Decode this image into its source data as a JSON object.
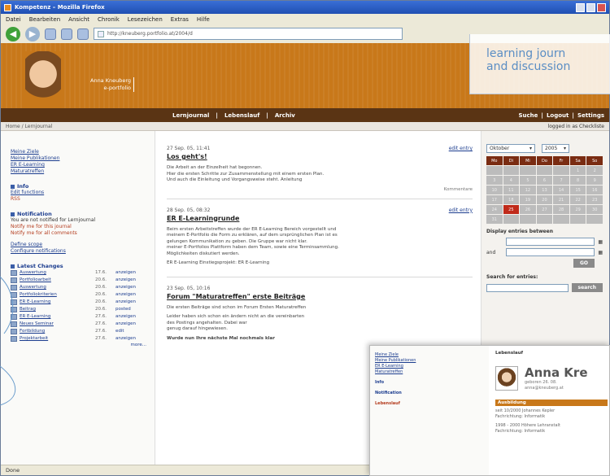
{
  "window": {
    "title": "Kompetenz – Mozilla Firefox",
    "menu": [
      "Datei",
      "Bearbeiten",
      "Ansicht",
      "Chronik",
      "Lesezeichen",
      "Extras",
      "Hilfe"
    ],
    "address": "http://kneuberg.portfolio.at/2004/d"
  },
  "callout": {
    "line1": "learning journ",
    "line2": "and discussion"
  },
  "banner": {
    "name_line1": "Anna Kneuberg",
    "name_line2": "e-portfolio"
  },
  "nav": {
    "main": [
      "Lernjournal",
      "Lebenslauf",
      "Archiv"
    ],
    "right": [
      "Suche",
      "Logout",
      "Settings"
    ]
  },
  "breadcrumb": {
    "path": "Home / Lernjournal",
    "login_info": "logged in as Checkliste"
  },
  "left": {
    "links": [
      "Meine Ziele",
      "Meine Publikationen",
      "ER E-Learning",
      "Maturatreffen"
    ],
    "info_title": "Info",
    "info_link": "Edit functions",
    "info_text": "RSS",
    "notify_title": "Notification",
    "notify_text": "You are not notified for Lernjournal",
    "notify_links": [
      "Notify me for this journal",
      "Notify me for all comments"
    ],
    "more_links": [
      "Define scope",
      "Configure notifications"
    ],
    "changes_title": "Latest Changes",
    "changes": [
      {
        "title": "Auswertung",
        "date": "17.6.",
        "action": "anzeigen"
      },
      {
        "title": "Portfolioarbeit",
        "date": "20.6.",
        "action": "anzeigen"
      },
      {
        "title": "Auswertung",
        "date": "20.6.",
        "action": "anzeigen"
      },
      {
        "title": "Portfoliokriterien",
        "date": "20.6.",
        "action": "anzeigen"
      },
      {
        "title": "ER E-Learning",
        "date": "20.6.",
        "action": "anzeigen"
      },
      {
        "title": "Beitrag",
        "date": "20.6.",
        "action": "posted"
      },
      {
        "title": "ER E-Learning",
        "date": "27.6.",
        "action": "anzeigen"
      },
      {
        "title": "Neues Seminar",
        "date": "27.6.",
        "action": "anzeigen"
      },
      {
        "title": "Fortbildung",
        "date": "27.6.",
        "action": "edit"
      },
      {
        "title": "Projektarbeit",
        "date": "27.6.",
        "action": "anzeigen"
      }
    ],
    "changes_more": "more..."
  },
  "posts": [
    {
      "meta": "27 Sep. 05, 11:41",
      "edit": "edit entry",
      "title": "Los geht's!",
      "body": [
        "Die Arbeit an der Einzelheit hat begonnen.",
        "Hier die ersten Schritte zur Zusammenstellung mit einem ersten Plan.",
        "Und auch die Einleitung und Vorgangsweise steht. Anleitung"
      ],
      "foot": "Kommentare"
    },
    {
      "meta": "28 Sep. 05, 08:32",
      "edit": "edit entry",
      "title": "ER E-Learningrunde",
      "body": [
        "Beim ersten Arbeitstreffen wurde der ER E-Learning Bereich vorgestellt und",
        "meinem E-Portfolio die Form zu erklären, auf dem ursprünglichen Plan ist es",
        "gelungen Kommunikation zu geben. Die Gruppe war nicht klar.",
        "meiner E-Portfolios Plattform haben dem Team, sowie eine Terminsammlung.",
        "Möglichkeiten diskutiert werden."
      ],
      "body2": "ER E-Learning Einstiegsprojekt: ER E-Learning",
      "foot": ""
    },
    {
      "meta": "23 Sep. 05, 10:16",
      "edit": "",
      "title": "Forum \"Maturatreffen\" erste Beiträge",
      "body": [
        "Die ersten Beiträge sind schon im Forum Ersten Maturatreffen",
        "Leider haben sich schon ein ändern nicht an die vereinbarten",
        "des Postings angehalten. Dabei war",
        "genug darauf hingewiesen."
      ],
      "body2": "Wurde nun Ihre nächste Mal nochmals klar",
      "foot": ""
    }
  ],
  "calendar": {
    "month": "Oktober",
    "year": "2005",
    "days_header": [
      "Mo",
      "Di",
      "Mi",
      "Do",
      "Fr",
      "Sa",
      "So"
    ],
    "days": [
      "",
      "",
      "",
      "",
      "",
      "1",
      "2",
      "3",
      "4",
      "5",
      "6",
      "7",
      "8",
      "9",
      "10",
      "11",
      "12",
      "13",
      "14",
      "15",
      "16",
      "17",
      "18",
      "19",
      "20",
      "21",
      "22",
      "23",
      "24",
      "25",
      "26",
      "27",
      "28",
      "29",
      "30",
      "31",
      "",
      "",
      "",
      "",
      "",
      ""
    ],
    "today": "25"
  },
  "right": {
    "between_title": "Display entries between",
    "and_label": "and",
    "go_button": "GO",
    "search_title": "Search for entries:",
    "search_button": "search"
  },
  "status": {
    "text": "Done"
  },
  "inset": {
    "left_links": [
      "Meine Ziele",
      "Meine Publikationen",
      "ER E-Learning",
      "Maturatreffen"
    ],
    "left_h1": "Info",
    "left_h2": "Notification",
    "left_h3": "Lebenslauf",
    "right_label": "Lebenslauf",
    "name": "Anna Kre",
    "sub1": "geboren 26. 08.",
    "sub2": "anna@kneuberg.at",
    "section": "Ausbildung",
    "edu1": "seit 10/2000 Johannes Kepler",
    "edu2": "Fachrichtung: Informatik",
    "edu3": "1998 - 2000 Höhere Lehranstalt",
    "edu4": "Fachrichtung: Informatik"
  }
}
